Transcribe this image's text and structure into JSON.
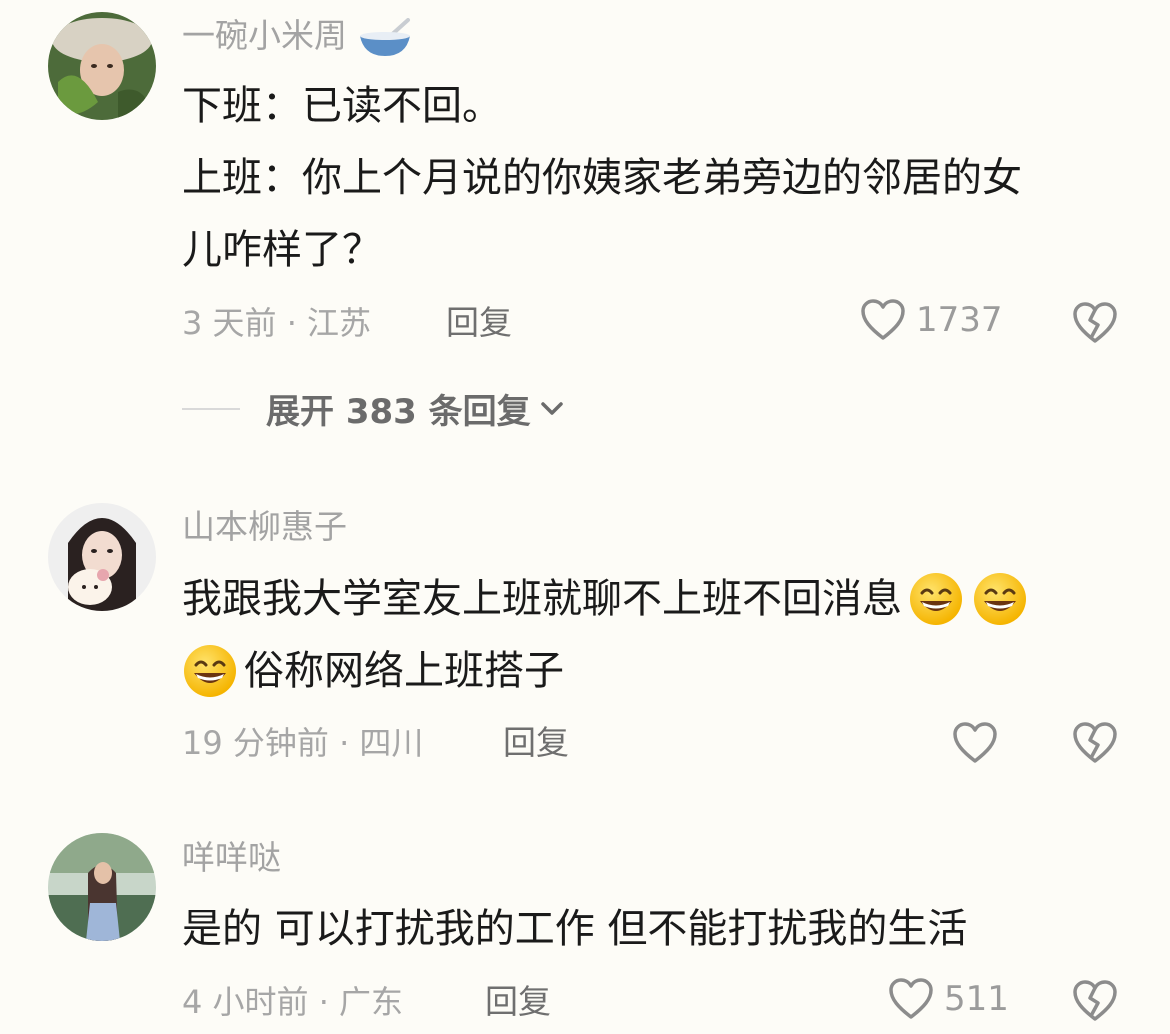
{
  "comments": [
    {
      "username": "一碗小米周",
      "username_icon": "bowl-icon",
      "lines": [
        "下班：已读不回。",
        "上班：你上个月说的你姨家老弟旁边的邻居的女",
        "儿咋样了？"
      ],
      "time_location": "3 天前 · 江苏",
      "reply_label": "回复",
      "likes": "1737",
      "expand_label": "展开 383 条回复"
    },
    {
      "username": "山本柳惠子",
      "line1": "我跟我大学室友上班就聊不上班不回消息",
      "line2": "俗称网络上班搭子",
      "emoji": "grinning-face-icon",
      "time_location": "19 分钟前 · 四川",
      "reply_label": "回复"
    },
    {
      "username": "咩咩哒",
      "lines": [
        "是的 可以打扰我的工作 但不能打扰我的生活"
      ],
      "time_location": "4 小时前 · 广东",
      "reply_label": "回复",
      "likes": "511"
    }
  ],
  "colors": {
    "background": "#fdfcf7",
    "username": "#a3a3a3",
    "body": "#1a1a1a",
    "meta": "#a6a6a6",
    "icon": "#8c8c8c"
  }
}
